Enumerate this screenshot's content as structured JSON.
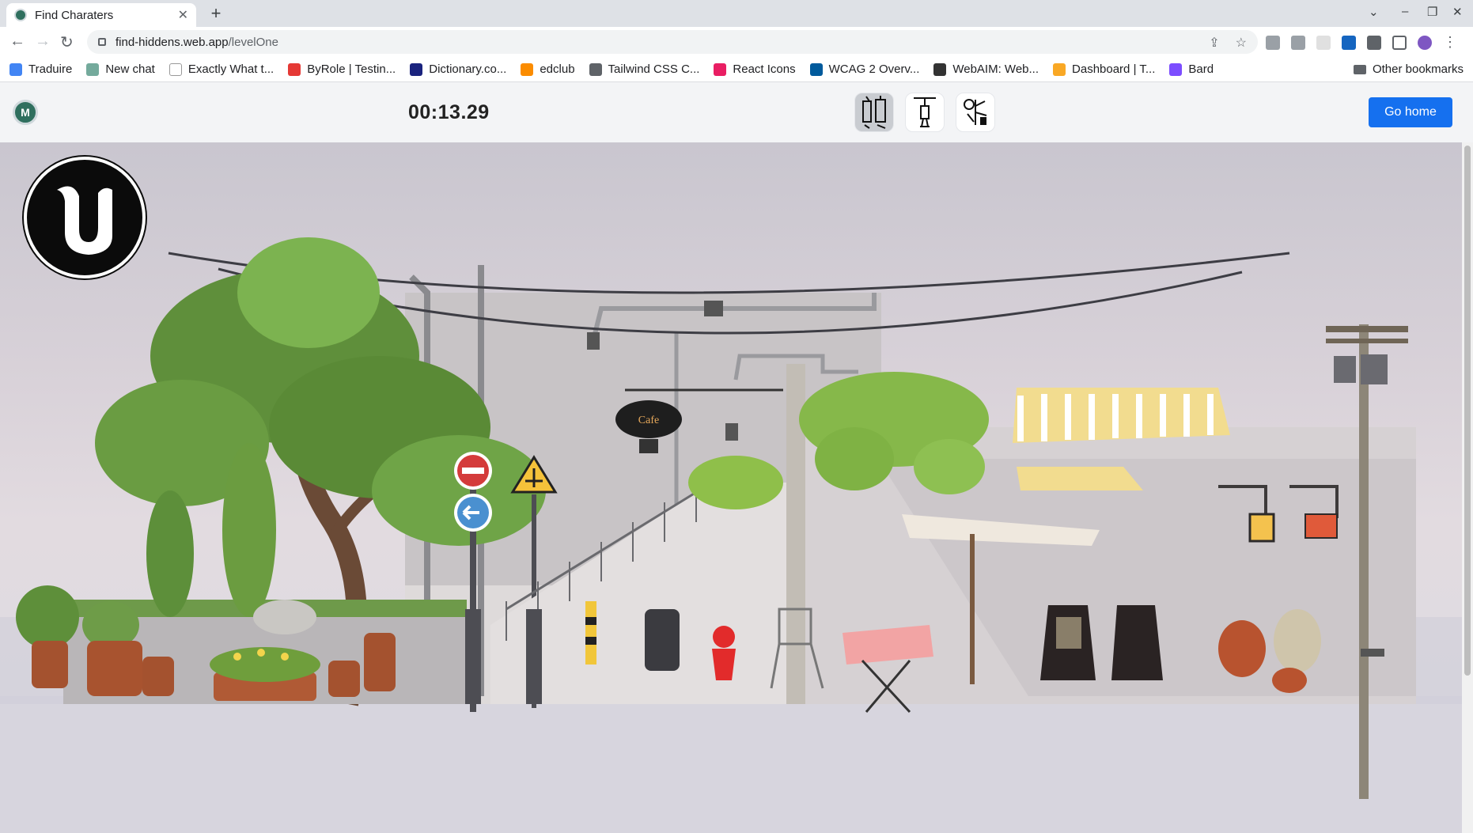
{
  "browser": {
    "tab_title": "Find Charaters",
    "url_host": "find-hiddens.web.app",
    "url_path": "/levelOne",
    "bookmarks": [
      {
        "label": "Traduire",
        "color": "#4285f4"
      },
      {
        "label": "New chat",
        "color": "#74aa9c"
      },
      {
        "label": "Exactly What t...",
        "color": "#ffffff"
      },
      {
        "label": "ByRole | Testin...",
        "color": "#e53935"
      },
      {
        "label": "Dictionary.co...",
        "color": "#1a237e"
      },
      {
        "label": "edclub",
        "color": "#fb8c00"
      },
      {
        "label": "Tailwind CSS C...",
        "color": "#5f6368"
      },
      {
        "label": "React Icons",
        "color": "#e91e63"
      },
      {
        "label": "WCAG 2 Overv...",
        "color": "#005a9c"
      },
      {
        "label": "WebAIM: Web...",
        "color": "#333333"
      },
      {
        "label": "Dashboard | T...",
        "color": "#f9a825"
      },
      {
        "label": "Bard",
        "color": "#7c4dff"
      }
    ],
    "other_bookmarks": "Other bookmarks"
  },
  "app": {
    "logo_text": "M",
    "timer": "00:13.29",
    "characters": [
      {
        "name": "character-1",
        "found": true
      },
      {
        "name": "character-2",
        "found": false
      },
      {
        "name": "character-3",
        "found": false
      }
    ],
    "go_home_label": "Go home"
  },
  "scene": {
    "logo": "unreal-engine",
    "sign_text": "Cafe"
  }
}
